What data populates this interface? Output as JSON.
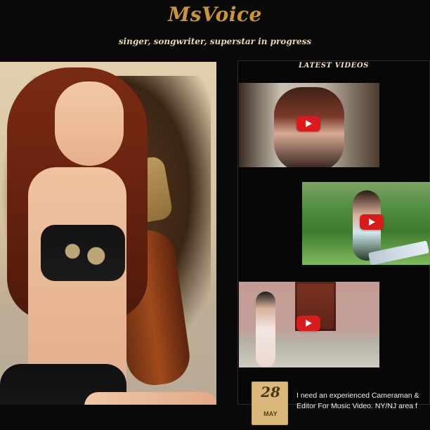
{
  "header": {
    "brand": "MsVoice",
    "tagline": "singer, songwriter, superstar in progress"
  },
  "videos": {
    "title": "LATEST VIDEOS",
    "items": [
      {
        "play_icon": "youtube-play-icon"
      },
      {
        "play_icon": "youtube-play-icon"
      },
      {
        "play_icon": "youtube-play-icon"
      }
    ]
  },
  "post": {
    "day": "28",
    "month": "MAY",
    "line1": "I need an experienced Cameraman &",
    "line2": "Editor For Music Video. NY/NJ area f"
  },
  "colors": {
    "background": "#0b0a0b",
    "brand": "#c8953a",
    "tagline": "#e6d6b4",
    "date_badge": "#d9b87a",
    "play": "#d91b1b"
  }
}
